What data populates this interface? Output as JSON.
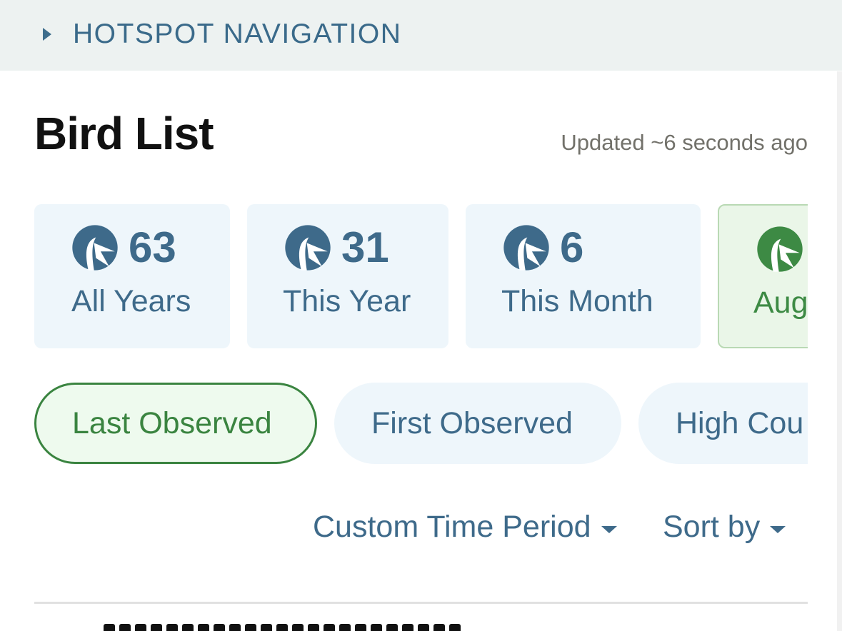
{
  "nav": {
    "label": "HOTSPOT NAVIGATION"
  },
  "header": {
    "title": "Bird List",
    "updated": "Updated ~6 seconds ago"
  },
  "cards": [
    {
      "count": "63",
      "label": "All Years",
      "active": false
    },
    {
      "count": "31",
      "label": "This Year",
      "active": false
    },
    {
      "count": "6",
      "label": "This Month",
      "active": false
    },
    {
      "count": "",
      "label": "Aug",
      "active": true
    }
  ],
  "filters": {
    "last_observed": "Last Observed",
    "first_observed": "First Observed",
    "high_count": "High Cou"
  },
  "controls": {
    "time_period": "Custom Time Period",
    "sort_by": "Sort by"
  },
  "colors": {
    "blue": "#3e6a8a",
    "green": "#3d8a44",
    "card_bg": "#eef6fb",
    "active_bg": "#eaf6e8"
  },
  "icons": {
    "bird": "bird-icon",
    "nav_toggle": "caret-right-icon",
    "dropdown": "caret-down-icon"
  }
}
